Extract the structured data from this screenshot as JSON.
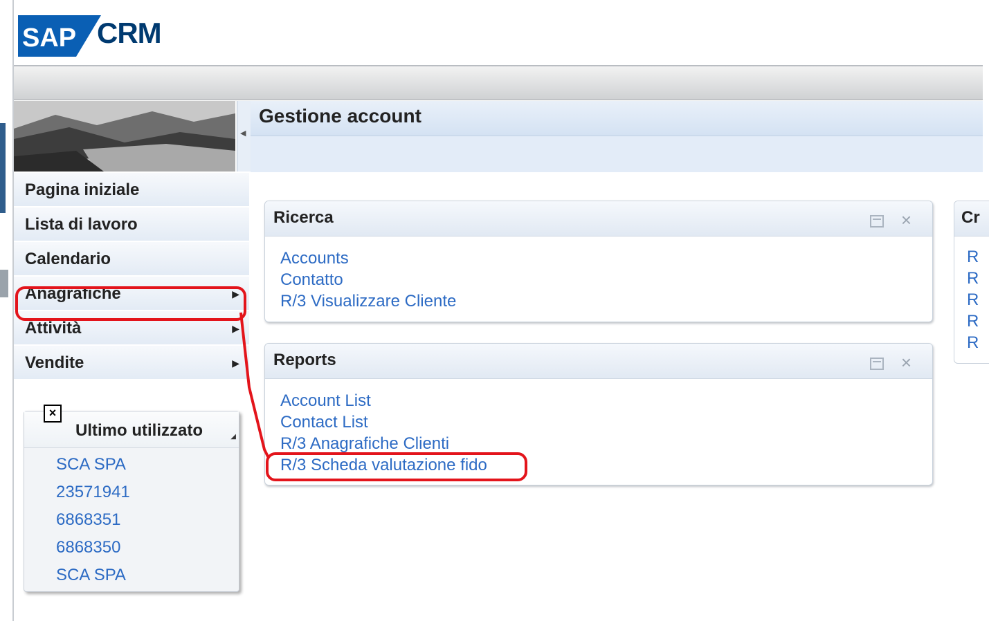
{
  "header": {
    "logo_text": "SAP",
    "product": "CRM"
  },
  "sidebar": {
    "items": [
      {
        "label": "Pagina iniziale",
        "has_submenu": false
      },
      {
        "label": "Lista di lavoro",
        "has_submenu": false
      },
      {
        "label": "Calendario",
        "has_submenu": false
      },
      {
        "label": "Anagrafiche",
        "has_submenu": true
      },
      {
        "label": "Attività",
        "has_submenu": true
      },
      {
        "label": "Vendite",
        "has_submenu": true
      }
    ],
    "recent": {
      "title": "Ultimo utilizzato",
      "items": [
        "SCA SPA",
        "23571941",
        "6868351",
        "6868350",
        "SCA SPA"
      ]
    }
  },
  "main": {
    "title": "Gestione account",
    "panels": {
      "ricerca": {
        "title": "Ricerca",
        "links": [
          "Accounts",
          "Contatto",
          "R/3 Visualizzare Cliente"
        ]
      },
      "reports": {
        "title": "Reports",
        "links": [
          "Account List",
          "Contact List",
          "R/3 Anagrafiche Clienti",
          "R/3 Scheda valutazione fido"
        ]
      },
      "crea": {
        "title": "Cr",
        "links": [
          "R",
          "R",
          "R",
          "R",
          "R"
        ]
      }
    }
  },
  "colors": {
    "link": "#2d6bc4",
    "annotation": "#e3141b",
    "brand": "#003a70"
  }
}
